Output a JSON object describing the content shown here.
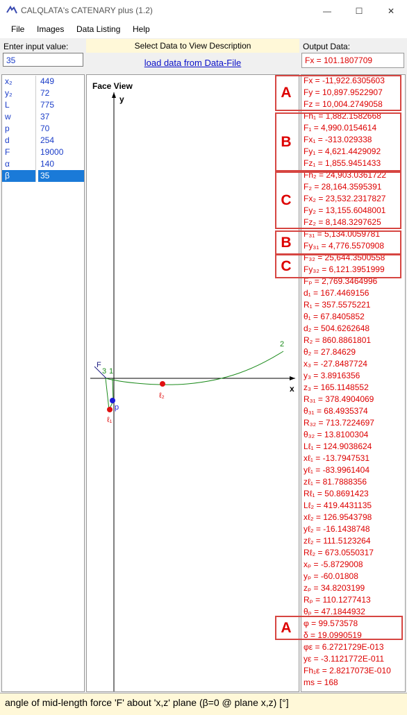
{
  "window": {
    "title": "CALQLATA's  CATENARY plus (1.2)",
    "minimize": "—",
    "maximize": "☐",
    "close": "✕"
  },
  "menu": [
    "File",
    "Images",
    "Data Listing",
    "Help"
  ],
  "input": {
    "label": "Enter input value:",
    "value": "35"
  },
  "center": {
    "heading": "Select Data to View Description",
    "load_link": "load data from Data-File"
  },
  "output": {
    "label": "Output Data:",
    "value": "Fx = 101.1807709"
  },
  "params": [
    {
      "name": "x₂",
      "value": "449"
    },
    {
      "name": "y₂",
      "value": "72"
    },
    {
      "name": "L",
      "value": "775"
    },
    {
      "name": "w",
      "value": "37"
    },
    {
      "name": "p",
      "value": "70"
    },
    {
      "name": "d",
      "value": "254"
    },
    {
      "name": "F",
      "value": "19000"
    },
    {
      "name": "α",
      "value": "140"
    },
    {
      "name": "β",
      "value": "35",
      "selected": true
    }
  ],
  "plot": {
    "title": "Face View",
    "y_label": "y",
    "x_label": "x",
    "labels": [
      "F",
      "3",
      "1",
      "2",
      "p",
      "ℓ₁",
      "ℓ₂"
    ],
    "colors": {
      "curve": "#1a8a1a",
      "point_red": "#e01010",
      "point_blue": "#1a1ad8",
      "axis": "#000"
    }
  },
  "results": [
    "Fx = -11,922.6305603",
    "Fy = 10,897.9522907",
    "Fz = 10,004.2749058",
    "Fh₁ = 1,882.1582668",
    "F₁ = 4,990.0154614",
    "Fx₁ = -313.029338",
    "Fy₁ = 4,621.4429092",
    "Fz₁ = 1,855.9451433",
    "Fh₂ = 24,903.0361722",
    "F₂ = 28,164.3595391",
    "Fx₂ = 23,532.2317827",
    "Fy₂ = 13,155.6048001",
    "Fz₂ = 8,148.3297625",
    "F₃₁ = 5,134.0059781",
    "Fy₃₁ = 4,776.5570908",
    "F₃₂ = 25,644.3500558",
    "Fy₃₂ = 6,121.3951999",
    "Fₚ = 2,769.3464996",
    "d₁ = 167.4469156",
    "R₁ = 357.5575221",
    "θ₁ = 67.8405852",
    "d₂ = 504.6262648",
    "R₂ = 860.8861801",
    "θ₂ = 27.84629",
    "x₃ = -27.8487724",
    "y₃ = 3.8916356",
    "z₃ = 165.1148552",
    "R₃₁ = 378.4904069",
    "θ₃₁ = 68.4935374",
    "R₃₂ = 713.7224697",
    "θ₃₂ = 13.8100304",
    "Lℓ₁ = 124.9038624",
    "xℓ₁ = -13.7947531",
    "yℓ₁ = -83.9961404",
    "zℓ₁ = 81.7888356",
    "Rℓ₁ = 50.8691423",
    "Lℓ₂ = 419.4431135",
    "xℓ₂ = 126.9543798",
    "yℓ₂ = -16.1438748",
    "zℓ₂ = 111.5123264",
    "Rℓ₂ = 673.0550317",
    "xₚ = -5.8729008",
    "yₚ = -60.01808",
    "zₚ = 34.8203199",
    "Rₚ = 110.1277413",
    "θₚ = 47.1844932",
    "φ = 99.573578",
    "δ = 19.0990519",
    "φε = 6.2721729E-013",
    "yε = -3.1121772E-011",
    "Fh₁ε = 2.8217073E-010",
    "ms = 168"
  ],
  "groups": [
    "A",
    "B",
    "C",
    "B",
    "C",
    "A"
  ],
  "status": "angle of mid-length force 'F' about 'x,z' plane (β=0 @ plane x,z) [°]"
}
